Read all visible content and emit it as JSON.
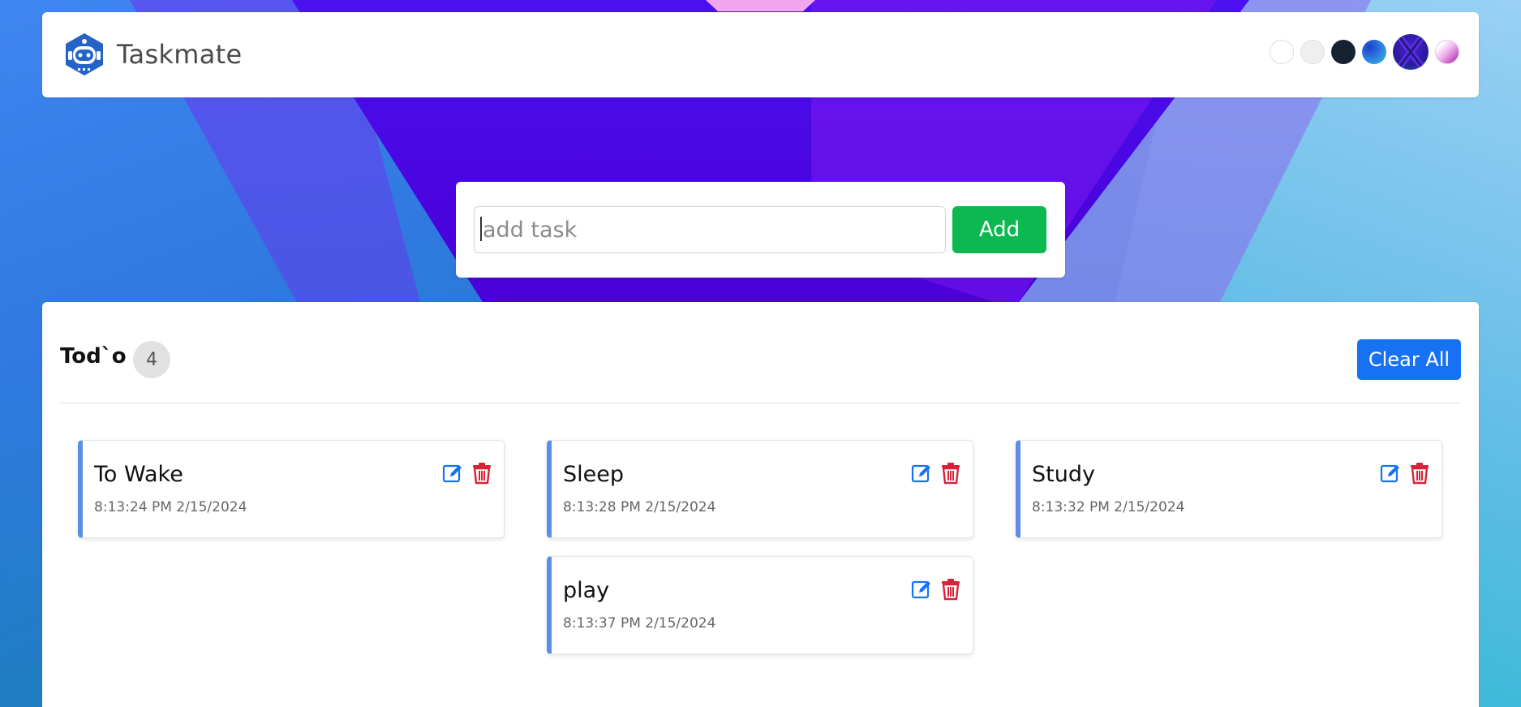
{
  "app": {
    "name": "Taskmate",
    "theme_swatches": [
      "#ffffff",
      "#efefef",
      "#172230",
      "blue-gradient",
      "x-gradient",
      "pink-gradient"
    ]
  },
  "add_task": {
    "placeholder": "add task",
    "value": "",
    "button_label": "Add"
  },
  "todo": {
    "title": "Tod`o",
    "count": "4",
    "clear_label": "Clear All",
    "tasks": [
      {
        "name": "To Wake",
        "time": "8:13:24 PM 2/15/2024"
      },
      {
        "name": "Sleep",
        "time": "8:13:28 PM 2/15/2024"
      },
      {
        "name": "Study",
        "time": "8:13:32 PM 2/15/2024"
      },
      {
        "name": "play",
        "time": "8:13:37 PM 2/15/2024"
      }
    ]
  },
  "icons": {
    "logo": "robot-logo-icon",
    "edit": "edit-icon",
    "delete": "trash-icon"
  },
  "colors": {
    "accent": "#1672f2",
    "add_button": "#0cb84f",
    "delete": "#d9223a",
    "task_border": "#5b8fe6"
  }
}
